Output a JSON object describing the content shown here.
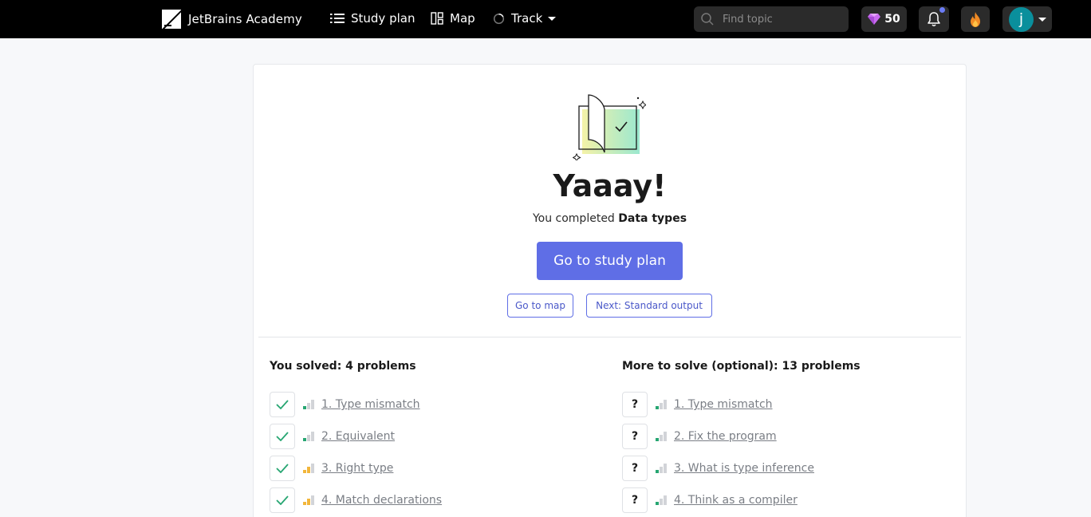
{
  "header": {
    "brand": "JetBrains Academy",
    "nav": {
      "study_plan": "Study plan",
      "map": "Map",
      "track": "Track"
    },
    "search": {
      "placeholder": "Find topic"
    },
    "gems": "50",
    "avatar_letter": "j"
  },
  "completion": {
    "title": "Yaaay!",
    "subtitle_prefix": "You completed",
    "topic": "Data types",
    "primary_button": "Go to study plan",
    "map_button": "Go to map",
    "next_button": "Next: Standard output"
  },
  "solved": {
    "title": "You solved: 4 problems",
    "items": [
      {
        "label": "1. Type mismatch",
        "difficulty": "easy"
      },
      {
        "label": "2. Equivalent",
        "difficulty": "easy"
      },
      {
        "label": "3. Right type",
        "difficulty": "medium"
      },
      {
        "label": "4. Match declarations",
        "difficulty": "medium"
      }
    ]
  },
  "optional": {
    "title": "More to solve (optional): 13 problems",
    "items": [
      {
        "label": "1. Type mismatch",
        "difficulty": "easy"
      },
      {
        "label": "2. Fix the program",
        "difficulty": "easy"
      },
      {
        "label": "3. What is type inference",
        "difficulty": "easy"
      },
      {
        "label": "4. Think as a compiler",
        "difficulty": "easy"
      }
    ]
  },
  "colors": {
    "accent": "#5f6ee6",
    "check": "#27a672",
    "easy": "#27a672",
    "medium": "#f2b63b",
    "avatar": "#0a8f9c"
  }
}
